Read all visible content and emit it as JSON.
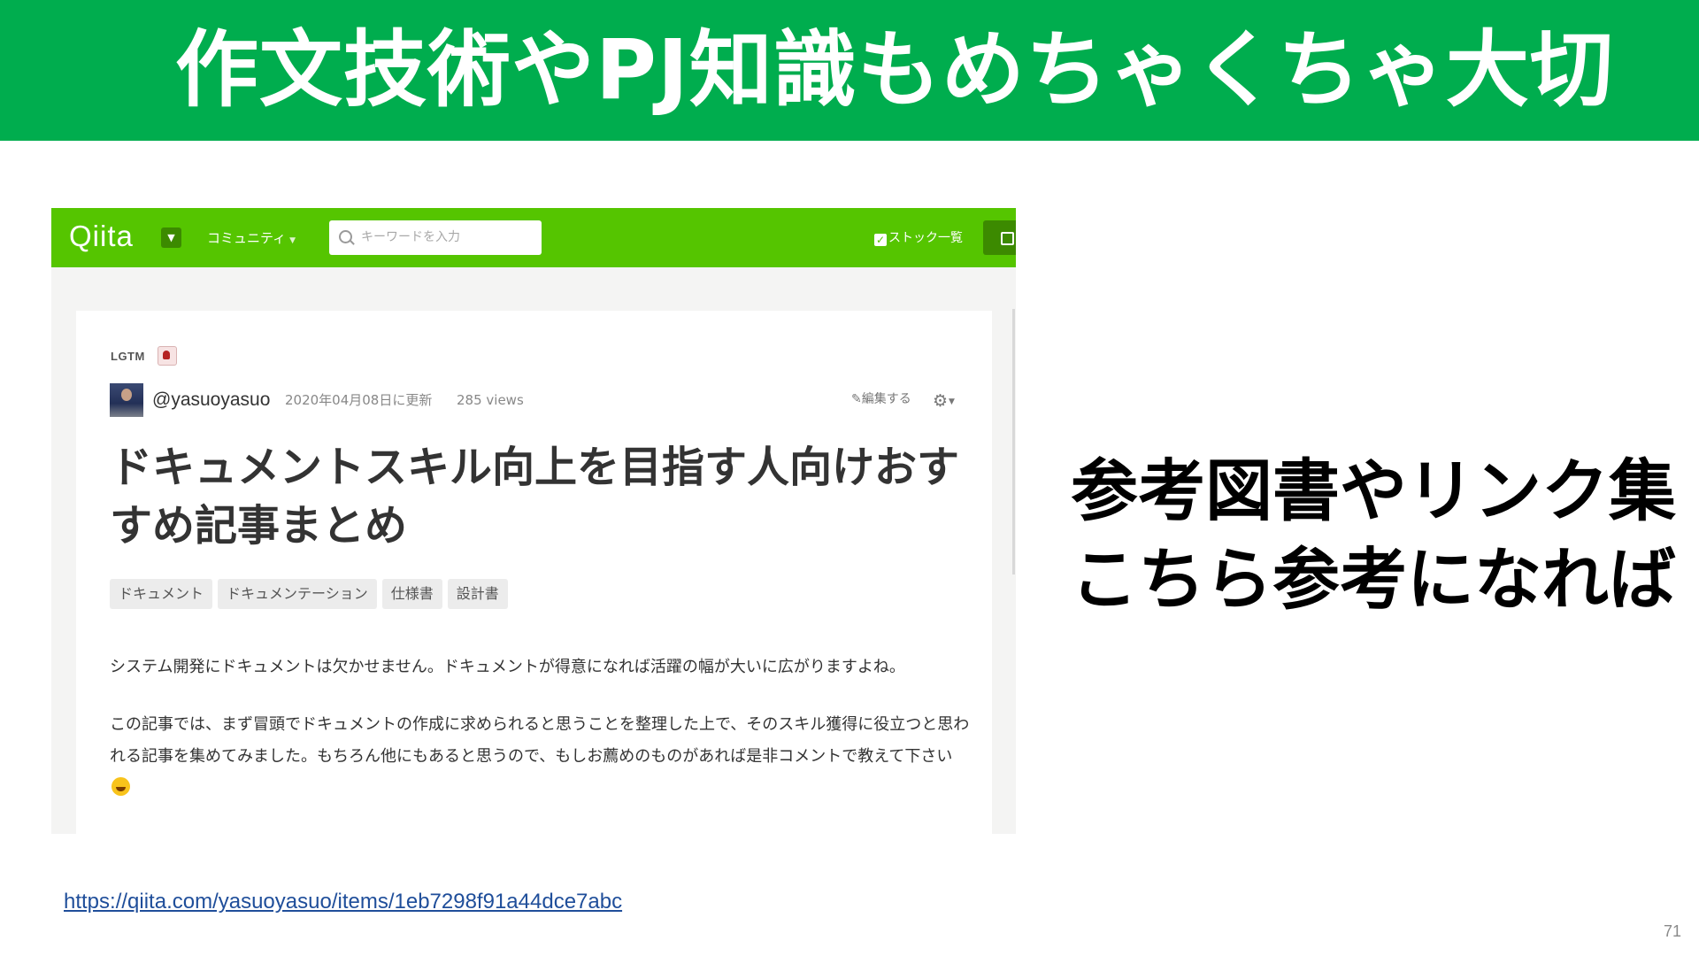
{
  "slide": {
    "title": "作文技術やPJ知識もめちゃくちゃ大切",
    "side_text_line1": "参考図書やリンク集",
    "side_text_line2": "こちら参考になれば",
    "link": "https://qiita.com/yasuoyasuo/items/1eb7298f91a44dce7abc",
    "page_number": "71"
  },
  "colors": {
    "banner_green": "#00ad4e",
    "qiita_green": "#55c500",
    "link_blue": "#1f4e9a"
  },
  "qiita": {
    "header": {
      "logo": "Qiita",
      "community_label": "コミュニティ",
      "search_placeholder": "キーワードを入力",
      "stock_label": "ストック一覧"
    },
    "article": {
      "lgtm_label": "LGTM",
      "author": "@yasuoyasuo",
      "updated": "2020年04月08日に更新",
      "views": "285 views",
      "edit_label": "編集する",
      "title": "ドキュメントスキル向上を目指す人向けおすすめ記事まとめ",
      "tags": [
        "ドキュメント",
        "ドキュメンテーション",
        "仕様書",
        "設計書"
      ],
      "paragraph1": "システム開発にドキュメントは欠かせません。ドキュメントが得意になれば活躍の幅が大いに広がりますよね。",
      "paragraph2": "この記事では、まず冒頭でドキュメントの作成に求められると思うことを整理した上で、そのスキル獲得に役立つと思われる記事を集めてみました。もちろん他にもあると思うので、もしお薦めのものがあれば是非コメントで教えて下さい"
    }
  }
}
